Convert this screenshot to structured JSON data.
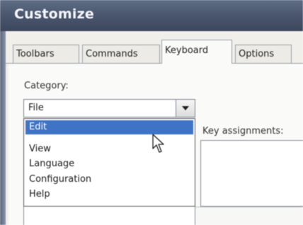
{
  "window": {
    "title": "Customize"
  },
  "tabs": [
    {
      "label": "Toolbars",
      "active": false
    },
    {
      "label": "Commands",
      "active": false
    },
    {
      "label": "Keyboard",
      "active": true
    },
    {
      "label": "Options",
      "active": false
    }
  ],
  "category": {
    "label": "Category:",
    "value": "File",
    "options": [
      {
        "label": "Edit",
        "selected": true
      },
      {
        "label": "View",
        "selected": false
      },
      {
        "label": "Language",
        "selected": false
      },
      {
        "label": "Configuration",
        "selected": false
      },
      {
        "label": "Help",
        "selected": false
      }
    ]
  },
  "key_assignments": {
    "label": "Key assignments:"
  },
  "colors": {
    "title_bar": "#4c5870",
    "selection": "#3f73c6"
  },
  "icons": {
    "dropdown_button": "chevron-down-icon",
    "pointer": "mouse-cursor-icon"
  }
}
